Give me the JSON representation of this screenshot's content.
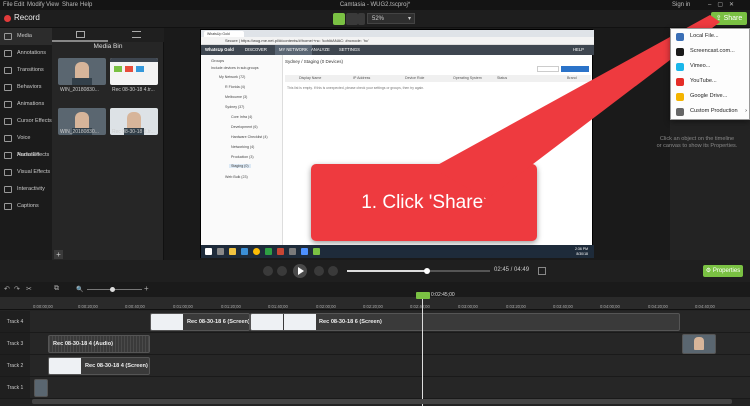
{
  "menubar": {
    "items": [
      "File",
      "Edit",
      "Modify",
      "View",
      "Share",
      "Help"
    ],
    "window_title": "Camtasia - WUG2.tscproj*",
    "sign_in": "Sign in"
  },
  "toolbar": {
    "record_label": "Record",
    "zoom_value": "52%",
    "share_label": "Share"
  },
  "sidebar": {
    "items": [
      {
        "label": "Media",
        "icon": "film-icon"
      },
      {
        "label": "Annotations",
        "icon": "annotation-icon"
      },
      {
        "label": "Transitions",
        "icon": "transition-icon"
      },
      {
        "label": "Behaviors",
        "icon": "behavior-icon"
      },
      {
        "label": "Animations",
        "icon": "animation-icon"
      },
      {
        "label": "Cursor Effects",
        "icon": "cursor-icon"
      },
      {
        "label": "Voice Narration",
        "icon": "microphone-icon"
      },
      {
        "label": "Audio Effects",
        "icon": "audio-icon"
      },
      {
        "label": "Visual Effects",
        "icon": "visual-effects-icon"
      },
      {
        "label": "Interactivity",
        "icon": "interactivity-icon"
      },
      {
        "label": "Captions",
        "icon": "captions-icon"
      }
    ]
  },
  "media_bin": {
    "title": "Media Bin",
    "items": [
      {
        "label": "WIN_20180830..."
      },
      {
        "label": "Rec 08-30-18 4.tr..."
      },
      {
        "label": "WIN_20180830..."
      },
      {
        "label": "Rec 08-30-18 6.tr..."
      }
    ],
    "add_label": "+"
  },
  "recording": {
    "browser_url": "Secure | https://wug.me.net.pl/#/contents/#/home/+nc: 'kohl#ANAC: #ncnode: 'hc'",
    "app_brand": "WhatsUp Gold",
    "nav": [
      "DISCOVER",
      "MY NETWORK",
      "ANALYZE",
      "SETTINGS",
      "HELP"
    ],
    "content_heading": "Sydney / Staging (0 Devices)",
    "columns": [
      "Display Name",
      "IP Address",
      "Device Role",
      "Operating System",
      "Status",
      "Brand"
    ],
    "empty_message": "This list is empty. If this is unexpected, please check your settings or groups, then try again.",
    "tree": [
      "Groups",
      "Include devices in sub-groups",
      "My Network (72)",
      "R Florida (4)",
      "Melbourne (3)",
      "Sydney (37)",
      "Core Infra (4)",
      "Development (6)",
      "Hardware Checklist (4)",
      "Networking (4)",
      "Production (3)",
      "Staging (0)",
      "Web Bulk (23)"
    ],
    "clock_time": "2:36 PM",
    "clock_date": "8/30/18"
  },
  "callout": {
    "text": "1. Click 'Share'"
  },
  "share_menu": {
    "items": [
      {
        "label": "Local File...",
        "color": "#3b6fb6"
      },
      {
        "label": "Screencast.com...",
        "color": "#1a1a1a"
      },
      {
        "label": "Vimeo...",
        "color": "#1ab7ea"
      },
      {
        "label": "YouTube...",
        "color": "#e52d27"
      },
      {
        "label": "Google Drive...",
        "color": "#f4b400"
      },
      {
        "label": "Custom Production",
        "color": "#666666"
      }
    ]
  },
  "properties_hint": {
    "line1": "Click an object on the timeline",
    "line2": "or canvas to show its Properties."
  },
  "playback": {
    "time": "02:45 / 04:49",
    "properties_label": "Properties"
  },
  "timeline": {
    "playhead_time": "0:02:45;00",
    "ticks": [
      "0:00:00;00",
      "0:00:20;00",
      "0:00:40;00",
      "0:01:00;00",
      "0:01:20;00",
      "0:01:40;00",
      "0:02:00;00",
      "0:02:20;00",
      "0:02:40;00",
      "0:03:00;00",
      "0:03:20;00",
      "0:03:40;00",
      "0:04:00;00",
      "0:04:20;00",
      "0:04:40;00"
    ],
    "tracks": [
      {
        "label": "Track 4"
      },
      {
        "label": "Track 3"
      },
      {
        "label": "Track 2"
      },
      {
        "label": "Track 1"
      }
    ],
    "clips": {
      "t4_a": "Rec 08-30-18 6 (Screen)",
      "t4_b": "Rec 08-30-18 6 (Screen)",
      "t3": "Rec 08-30-18 4 (Audio)",
      "t2": "Rec 08-30-18 4 (Screen)"
    }
  },
  "colors": {
    "accent_green": "#7ac143",
    "callout_red": "#ee3a3f",
    "record_red": "#e23b3b"
  }
}
